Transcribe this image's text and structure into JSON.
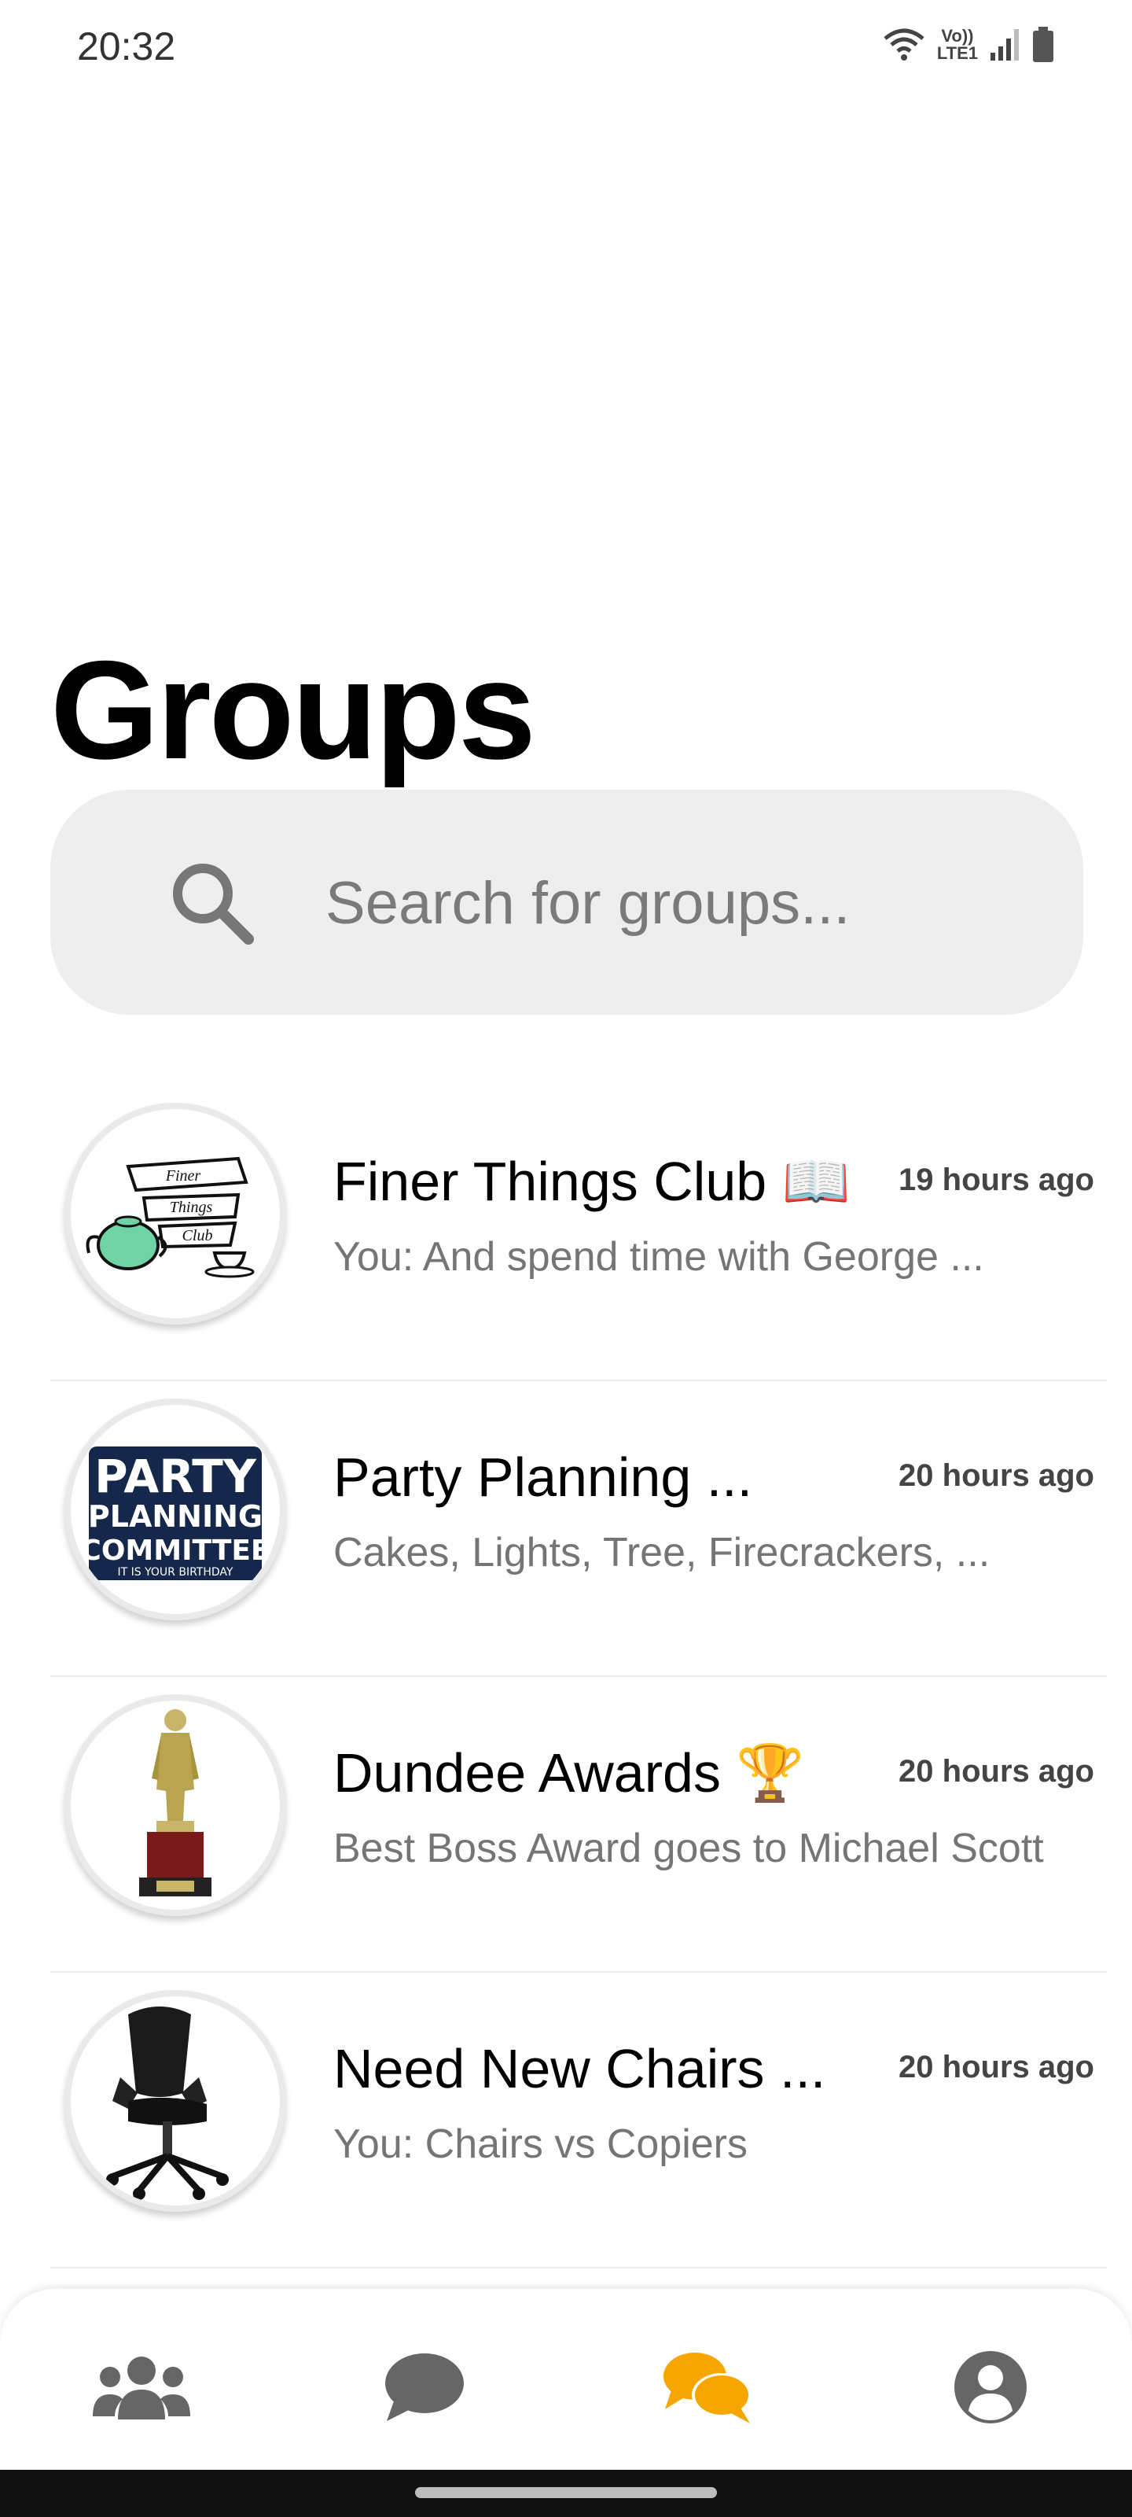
{
  "status": {
    "time": "20:32",
    "volte_top": "Vo))",
    "volte_bottom": "LTE1"
  },
  "title": "Groups",
  "search": {
    "placeholder": "Search for groups..."
  },
  "groups": [
    {
      "name": "Finer Things Club 📖",
      "time": "19 hours ago",
      "preview": "You: And spend time with George ...",
      "avatar_text": [
        "Finer",
        "Things",
        "Club"
      ]
    },
    {
      "name": "Party Planning ...",
      "time": "20 hours ago",
      "preview": "Cakes, Lights, Tree, Firecrackers, ...",
      "avatar_text": [
        "PARTY",
        "PLANNING",
        "COMMITTEE",
        "IT IS YOUR BIRTHDAY"
      ]
    },
    {
      "name": "Dundee Awards 🏆",
      "time": "20 hours ago",
      "preview": "Best Boss Award goes to Michael Scott"
    },
    {
      "name": "Need New Chairs ...",
      "time": "20 hours ago",
      "preview": "You: Chairs vs Copiers"
    }
  ],
  "nav": {
    "active_color": "#F7A600",
    "inactive_color": "#666666"
  }
}
